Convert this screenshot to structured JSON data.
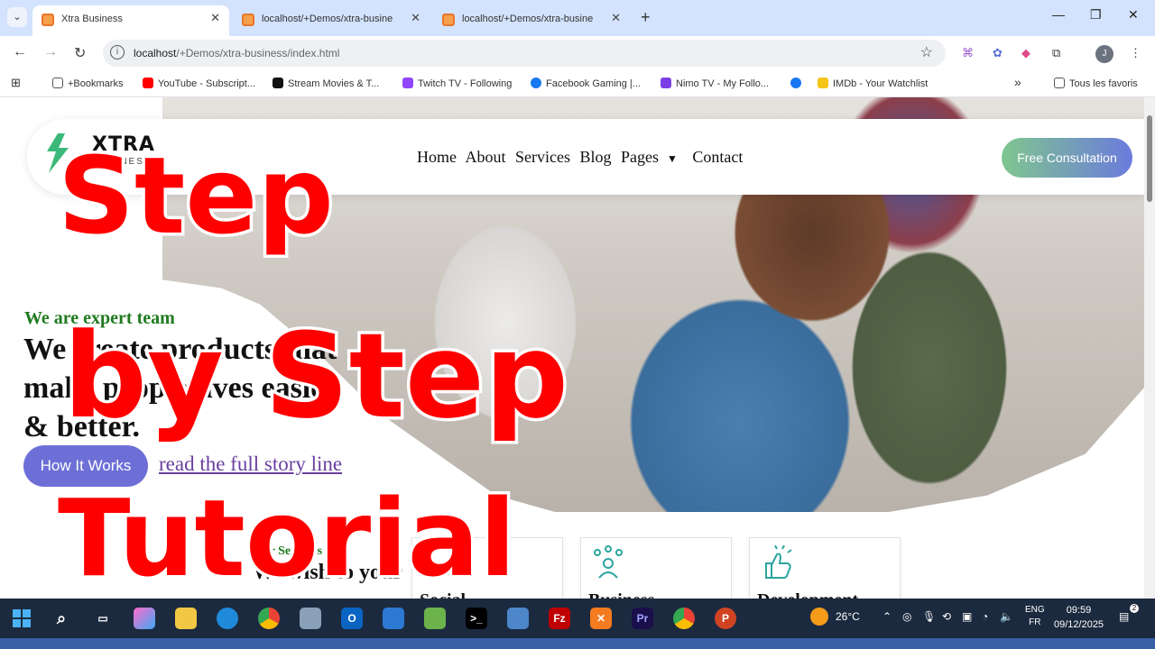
{
  "browser": {
    "tabs": [
      {
        "title": "Xtra Business",
        "active": true
      },
      {
        "title": "localhost/+Demos/xtra-busine",
        "active": false
      },
      {
        "title": "localhost/+Demos/xtra-busine",
        "active": false
      }
    ],
    "address": {
      "host": "localhost",
      "path": "/+Demos/xtra-business/index.html"
    },
    "avatar_letter": "J",
    "bookmarks": [
      "+Bookmarks",
      "YouTube - Subscript...",
      "Stream Movies & T...",
      "Twitch TV - Following",
      "Facebook Gaming |...",
      "Nimo TV - My Follo...",
      "",
      "IMDb - Your Watchlist"
    ],
    "bookmarks_overflow": "»",
    "all_bookmarks": "Tous les favoris"
  },
  "site": {
    "logo_text": "XTRA",
    "logo_sub": "BUSINESS",
    "nav": [
      "Home",
      "About",
      "Services",
      "Blog",
      "Pages",
      "Contact"
    ],
    "cta": "Free Consultation",
    "kicker": "We are expert team",
    "headline": "We create products that make people lives easier & better.",
    "how_button": "How It Works",
    "story_link": "read the full story line",
    "services_kicker": "Our Services",
    "services_title": "We wish to your",
    "cards": [
      {
        "title": "Social"
      },
      {
        "title": "Business"
      },
      {
        "title": "Development"
      }
    ]
  },
  "overlay": {
    "line1": "Step",
    "line2": "by Step",
    "line3": "Tutorial"
  },
  "taskbar": {
    "weather": "26°C",
    "lang_top": "ENG",
    "lang_bottom": "FR",
    "time": "09:59",
    "date": "09/12/2025",
    "notif_count": "2"
  },
  "colors": {
    "tabbar": "#d3e3fd",
    "kicker_green": "#1f7a1f",
    "cta_gradient": [
      "#7fc68f",
      "#6b7bdc"
    ],
    "how_button": "#6d6fd7",
    "overlay_red": "#ff0000",
    "taskbar": "#1c2a3f"
  }
}
